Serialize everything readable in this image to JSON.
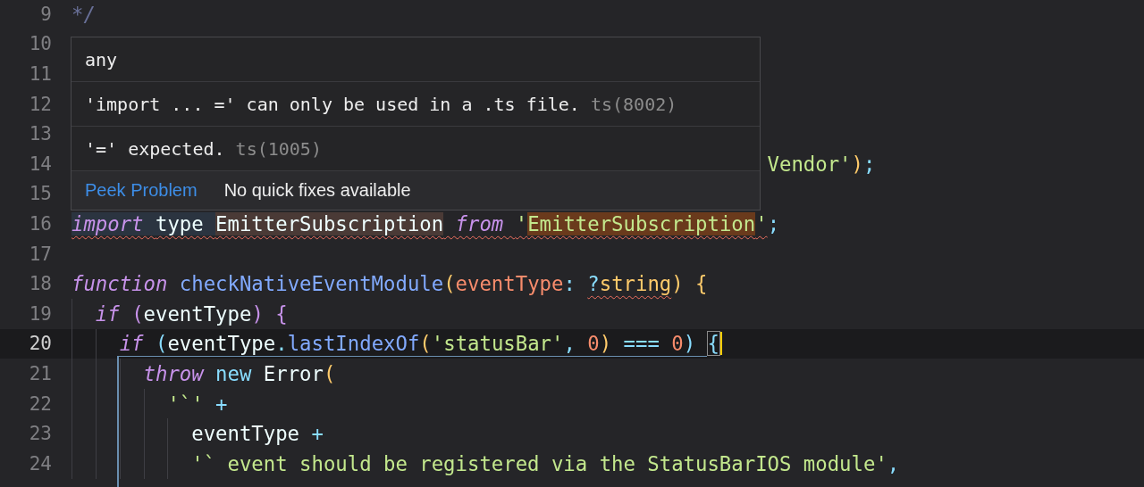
{
  "editor": {
    "lines": [
      {
        "number": "9",
        "current": false,
        "tokens": [
          {
            "text": "*/",
            "kind": "comment"
          }
        ]
      },
      {
        "number": "10",
        "current": false
      },
      {
        "number": "11",
        "current": false
      },
      {
        "number": "12",
        "current": false
      },
      {
        "number": "13",
        "current": false
      },
      {
        "number": "14",
        "current": false,
        "kind": "tail",
        "tokens": [
          {
            "text": "Vendor'",
            "kind": "string"
          },
          {
            "text": ")",
            "kind": "paren"
          },
          {
            "text": ";",
            "kind": "op"
          }
        ]
      },
      {
        "number": "15",
        "current": false
      },
      {
        "number": "16",
        "current": false,
        "tokens": [
          {
            "text": "import ",
            "kind": "keyword",
            "error": true,
            "word_highlight": true
          },
          {
            "text": "type ",
            "kind": "plain",
            "error": true,
            "word_highlight": true
          },
          {
            "text": "EmitterSubscription",
            "kind": "plain",
            "error": true,
            "symbol_highlight": true
          },
          {
            "text": " from ",
            "kind": "keyword",
            "error": true
          },
          {
            "text": "'",
            "kind": "string",
            "error": true
          },
          {
            "text": "EmitterSubscription",
            "kind": "string",
            "error": true,
            "match_highlight": true
          },
          {
            "text": "'",
            "kind": "string",
            "error": true
          },
          {
            "text": ";",
            "kind": "op"
          }
        ]
      },
      {
        "number": "17",
        "current": false
      },
      {
        "number": "18",
        "current": false,
        "tokens": [
          {
            "text": "function ",
            "kind": "keyword"
          },
          {
            "text": "checkNativeEventModule",
            "kind": "func"
          },
          {
            "text": "(",
            "kind": "paren"
          },
          {
            "text": "eventType",
            "kind": "param"
          },
          {
            "text": ": ",
            "kind": "op"
          },
          {
            "text": "?",
            "kind": "op",
            "error": true
          },
          {
            "text": "string",
            "kind": "type",
            "error": true
          },
          {
            "text": ") {",
            "kind": "paren"
          }
        ],
        "children": [
          {
            "number": "19",
            "current": false,
            "tokens": [
              {
                "text": "if ",
                "kind": "keyword"
              },
              {
                "text": "(",
                "kind": "brace"
              },
              {
                "text": "eventType",
                "kind": "plain"
              },
              {
                "text": ") {",
                "kind": "brace"
              }
            ],
            "children": [
              {
                "number": "20",
                "current": true,
                "tokens": [
                  {
                    "text": "if ",
                    "kind": "keyword"
                  },
                  {
                    "text": "(",
                    "kind": "op"
                  },
                  {
                    "text": "eventType",
                    "kind": "plain"
                  },
                  {
                    "text": ".",
                    "kind": "op"
                  },
                  {
                    "text": "lastIndexOf",
                    "kind": "func"
                  },
                  {
                    "text": "(",
                    "kind": "paren"
                  },
                  {
                    "text": "'statusBar'",
                    "kind": "string"
                  },
                  {
                    "text": ", ",
                    "kind": "op"
                  },
                  {
                    "text": "0",
                    "kind": "number"
                  },
                  {
                    "text": ") ",
                    "kind": "paren"
                  },
                  {
                    "text": "=== ",
                    "kind": "op"
                  },
                  {
                    "text": "0",
                    "kind": "number"
                  },
                  {
                    "text": ") ",
                    "kind": "op"
                  },
                  {
                    "text": "{",
                    "kind": "op",
                    "bracket_match": true
                  }
                ],
                "children": [
                  {
                    "number": "21",
                    "current": false,
                    "tokens": [
                      {
                        "text": "throw ",
                        "kind": "keyword"
                      },
                      {
                        "text": "new ",
                        "kind": "op"
                      },
                      {
                        "text": "Error",
                        "kind": "plain"
                      },
                      {
                        "text": "(",
                        "kind": "paren"
                      }
                    ],
                    "children": [
                      {
                        "number": "22",
                        "current": false,
                        "tokens": [
                          {
                            "text": "'`' ",
                            "kind": "string"
                          },
                          {
                            "text": "+",
                            "kind": "op"
                          }
                        ],
                        "children": [
                          {
                            "number": "23",
                            "current": false,
                            "tokens": [
                              {
                                "text": "eventType ",
                                "kind": "plain"
                              },
                              {
                                "text": "+",
                                "kind": "op"
                              }
                            ]
                          },
                          {
                            "number": "24",
                            "current": false,
                            "tokens": [
                              {
                                "text": "'` event should be registered via the StatusBarIOS module'",
                                "kind": "string"
                              },
                              {
                                "text": ",",
                                "kind": "op"
                              }
                            ]
                          }
                        ]
                      }
                    ]
                  }
                ]
              }
            ]
          }
        ]
      }
    ]
  },
  "hover": {
    "type": "any",
    "problems": [
      {
        "message": "'import ... =' can only be used in a .ts file.",
        "code": "ts(8002)"
      },
      {
        "message": "'=' expected.",
        "code": "ts(1005)"
      }
    ],
    "peek_link": "Peek Problem",
    "quick_fix_note": "No quick fixes available"
  }
}
